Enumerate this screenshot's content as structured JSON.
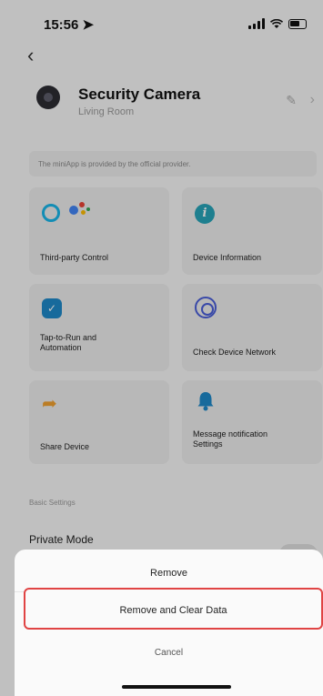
{
  "status": {
    "time": "15:56 ➤"
  },
  "device": {
    "name": "Security Camera",
    "room": "Living Room"
  },
  "provider_note": "The miniApp is provided by the official provider.",
  "tiles": [
    {
      "label": "Third-party Control"
    },
    {
      "label": "Device Information"
    },
    {
      "label": "Tap-to-Run and\nAutomation"
    },
    {
      "label": "Check Device Network"
    },
    {
      "label": "Share Device"
    },
    {
      "label": "Message notification\nSettings"
    }
  ],
  "settings": {
    "section": "Basic Settings",
    "private_mode": "Private Mode"
  },
  "sheet": {
    "remove": "Remove",
    "remove_clear": "Remove and Clear Data",
    "cancel": "Cancel"
  },
  "colors": {
    "highlight": "#e04444",
    "alexa": "#19b5e8",
    "info": "#27a3b8",
    "tap": "#1e88c8",
    "network": "#4a5ed8",
    "share": "#f0a030",
    "bell": "#1e88c8"
  }
}
